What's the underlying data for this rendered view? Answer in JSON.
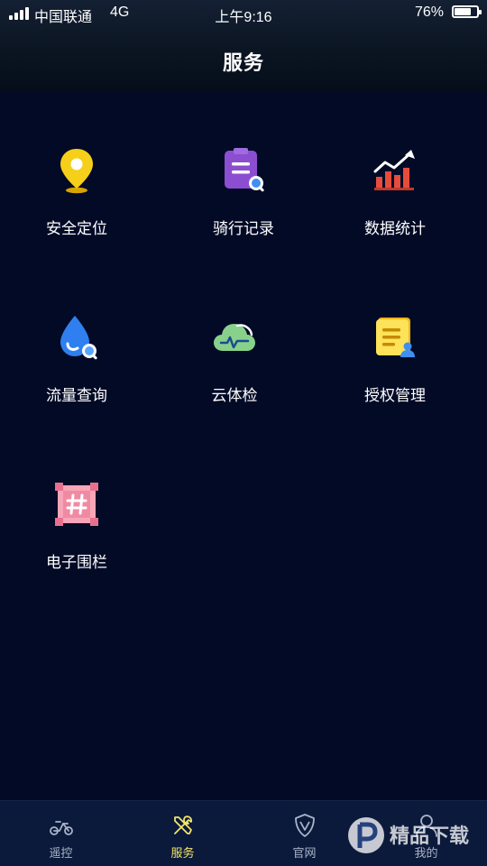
{
  "status_bar": {
    "carrier": "中国联通",
    "network": "4G",
    "time": "上午9:16",
    "battery": "76%",
    "battery_level": 0.76
  },
  "header": {
    "title": "服务"
  },
  "services": [
    {
      "label": "安全定位",
      "icon": "location-pin-icon"
    },
    {
      "label": "骑行记录",
      "icon": "ride-record-icon"
    },
    {
      "label": "数据统计",
      "icon": "statistics-chart-icon"
    },
    {
      "label": "流量查询",
      "icon": "data-drop-search-icon"
    },
    {
      "label": "云体检",
      "icon": "cloud-checkup-icon"
    },
    {
      "label": "授权管理",
      "icon": "authorization-icon"
    },
    {
      "label": "电子围栏",
      "icon": "geo-fence-icon"
    }
  ],
  "tabbar": {
    "tabs": [
      {
        "label": "遥控",
        "icon": "scooter-icon",
        "active": false
      },
      {
        "label": "服务",
        "icon": "tools-icon",
        "active": true
      },
      {
        "label": "官网",
        "icon": "shield-icon",
        "active": false
      },
      {
        "label": "我的",
        "icon": "person-icon",
        "active": false
      }
    ]
  },
  "colors": {
    "background": "#020a26",
    "tabbar": "#0b1a3b",
    "active_tab": "#f3e56a",
    "inactive_tab": "#aab4c8"
  },
  "watermark": {
    "text": "精品下载"
  }
}
